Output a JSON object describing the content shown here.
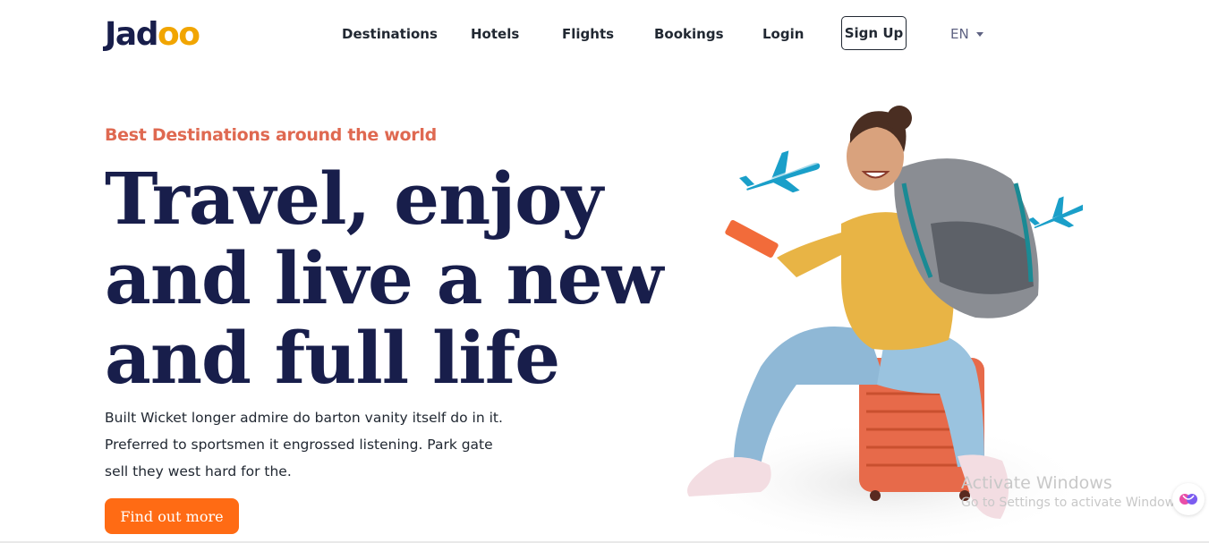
{
  "brand": {
    "logo_prefix": "Jad",
    "logo_suffix": "oo"
  },
  "nav": {
    "items": [
      {
        "label": "Destinations"
      },
      {
        "label": "Hotels"
      },
      {
        "label": "Flights"
      },
      {
        "label": "Bookings"
      },
      {
        "label": "Login"
      }
    ],
    "signup_label": "Sign Up",
    "language": "EN"
  },
  "hero": {
    "tagline": "Best Destinations around the world",
    "headline": [
      "Travel, enjoy",
      "and live a new",
      "and full life"
    ],
    "description": [
      "Built Wicket longer admire do barton vanity itself do in it.",
      "Preferred to sportsmen it engrossed listening. Park gate",
      "sell they west hard for the."
    ],
    "cta_label": "Find out more"
  },
  "watermark": {
    "title": "Activate Windows",
    "subtitle": "Go to Settings to activate Windows."
  },
  "colors": {
    "brand_dark": "#181E4B",
    "accent_orange": "#DF6951",
    "cta_orange": "#FF6B14",
    "logo_yellow": "#F1A501"
  },
  "icons": [
    "caret-down-icon",
    "airplane-icon",
    "assistant-brain-icon"
  ]
}
